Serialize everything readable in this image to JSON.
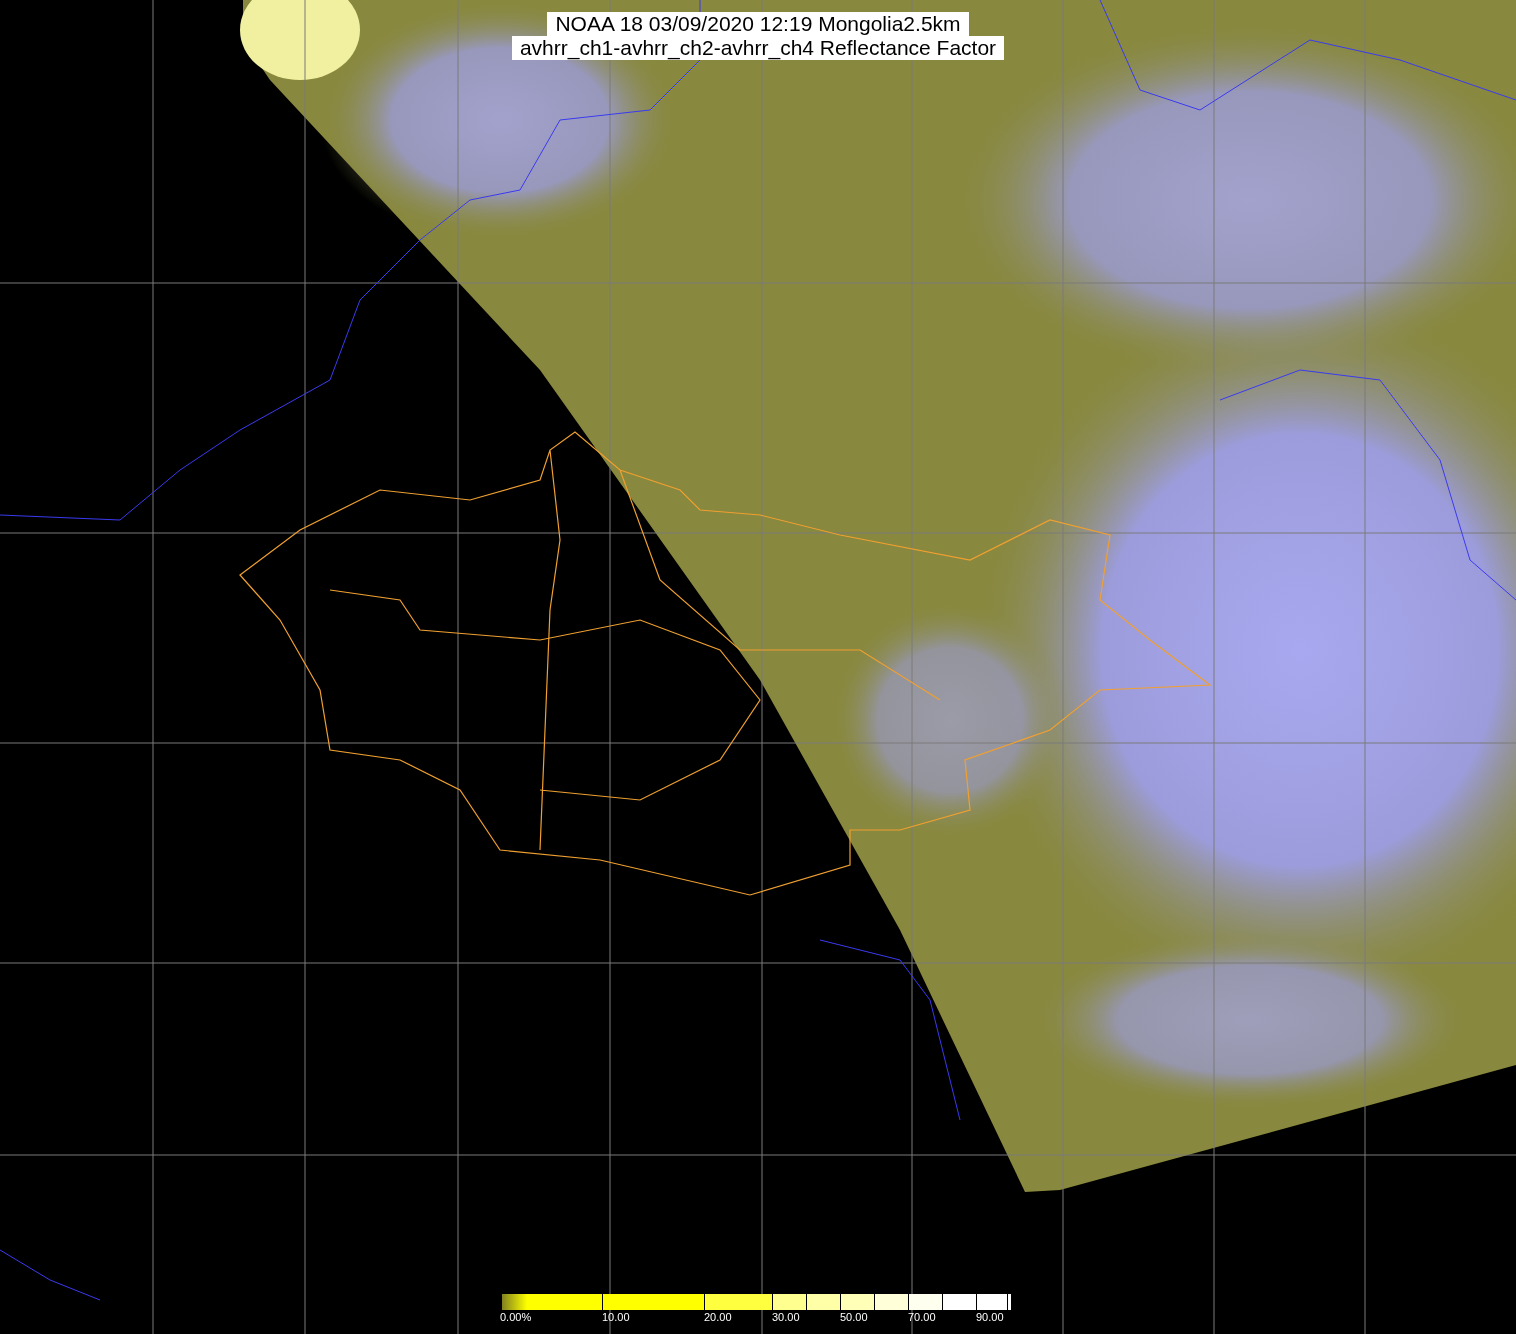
{
  "title": {
    "lines": [
      "NOAA 18 03/09/2020 12:19 Mongolia2.5km",
      "avhrr_ch1-avhrr_ch2-avhrr_ch4 Reflectance Factor"
    ]
  },
  "colorbar": {
    "tick_labels": [
      "0.00%",
      "10.00",
      "20.00",
      "30.00",
      "50.00",
      "70.00",
      "90.00"
    ]
  }
}
